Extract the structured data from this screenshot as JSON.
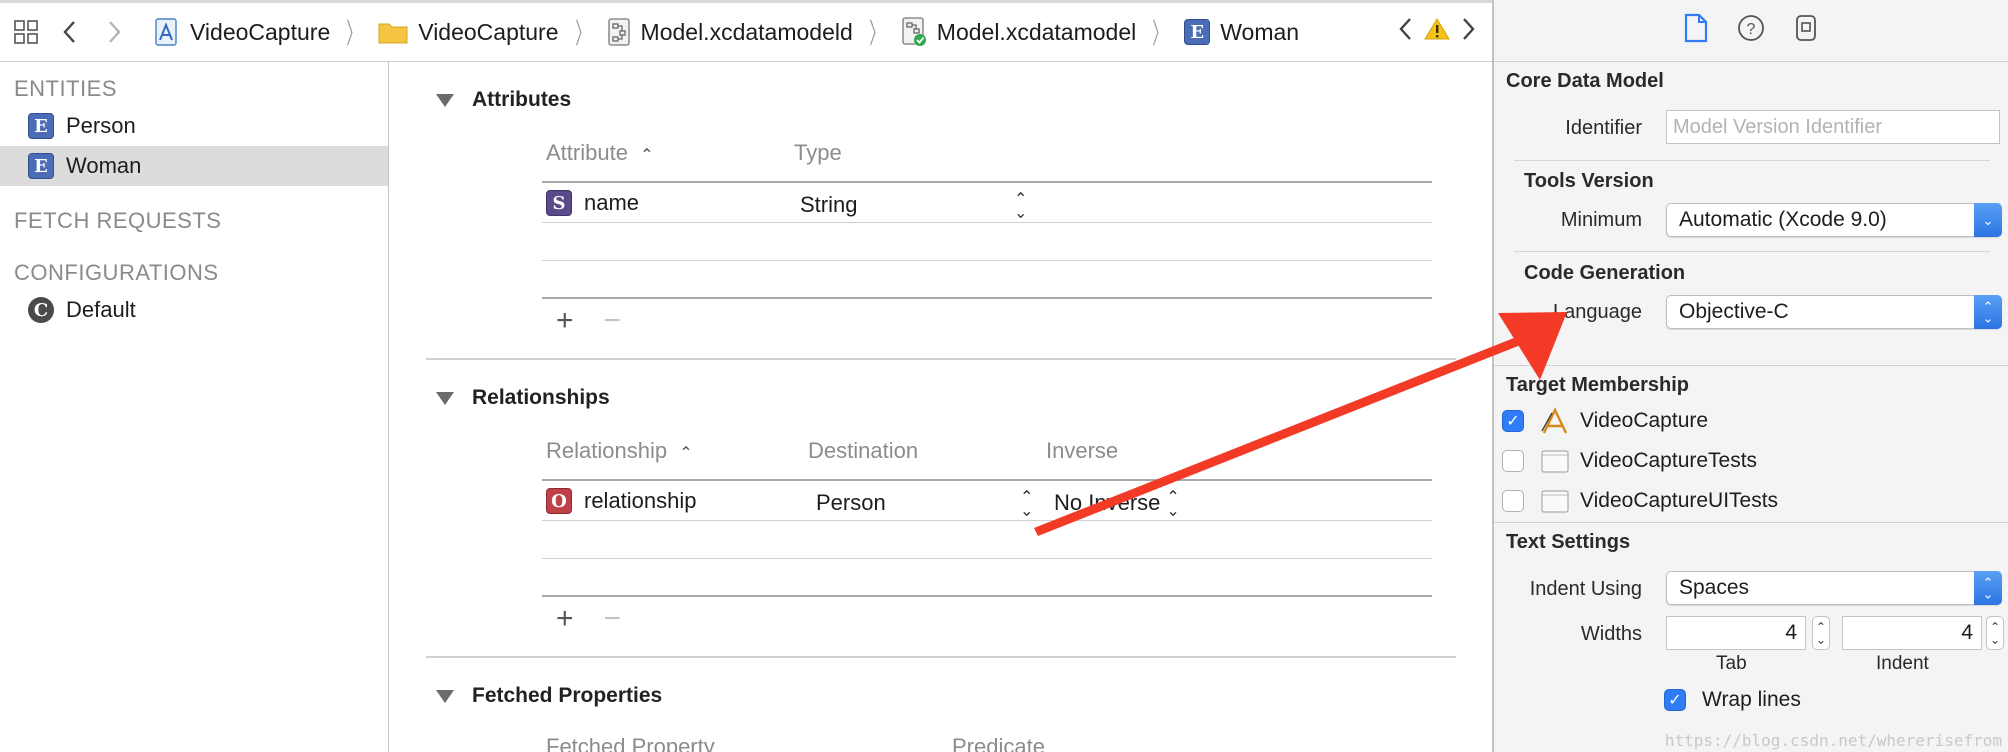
{
  "jumpbar": {
    "crumbs": [
      "VideoCapture",
      "VideoCapture",
      "Model.xcdatamodeld",
      "Model.xcdatamodel",
      "Woman"
    ]
  },
  "outline": {
    "entities_title": "ENTITIES",
    "entities": [
      "Person",
      "Woman"
    ],
    "selected_entity": "Woman",
    "fetch_title": "FETCH REQUESTS",
    "configurations_title": "CONFIGURATIONS",
    "configurations": [
      "Default"
    ]
  },
  "editor": {
    "attributes": {
      "title": "Attributes",
      "col_attribute": "Attribute",
      "col_type": "Type",
      "rows": [
        {
          "badge": "S",
          "name": "name",
          "type": "String"
        }
      ]
    },
    "relationships": {
      "title": "Relationships",
      "col_relationship": "Relationship",
      "col_destination": "Destination",
      "col_inverse": "Inverse",
      "rows": [
        {
          "badge": "O",
          "name": "relationship",
          "destination": "Person",
          "inverse": "No Inverse"
        }
      ]
    },
    "fetched": {
      "title": "Fetched Properties",
      "col_property": "Fetched Property",
      "col_predicate": "Predicate"
    }
  },
  "inspector": {
    "core_data_model": "Core Data Model",
    "identifier_label": "Identifier",
    "identifier_placeholder": "Model Version Identifier",
    "tools_version": "Tools Version",
    "minimum_label": "Minimum",
    "minimum_value": "Automatic (Xcode 9.0)",
    "code_generation": "Code Generation",
    "language_label": "Language",
    "language_value": "Objective-C",
    "target_membership": "Target Membership",
    "targets": [
      {
        "name": "VideoCapture",
        "checked": true
      },
      {
        "name": "VideoCaptureTests",
        "checked": false
      },
      {
        "name": "VideoCaptureUITests",
        "checked": false
      }
    ],
    "text_settings": "Text Settings",
    "indent_using_label": "Indent Using",
    "indent_using_value": "Spaces",
    "widths_label": "Widths",
    "tab_value": "4",
    "indent_value": "4",
    "tab_caption": "Tab",
    "indent_caption": "Indent",
    "wrap_lines_label": "Wrap lines",
    "wrap_lines_checked": true
  },
  "annotation": {
    "arrow_color": "#f23a26"
  },
  "watermark": "https://blog.csdn.net/whererisefrom"
}
